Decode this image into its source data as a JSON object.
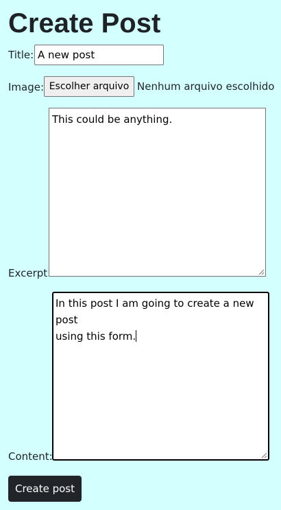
{
  "page": {
    "title": "Create Post"
  },
  "form": {
    "title_label": "Title:",
    "title_value": "A new post",
    "image_label": "Image:",
    "file_button_label": "Escolher arquivo",
    "file_status": "Nenhum arquivo escolhido",
    "excerpt_label": "Excerpt:",
    "excerpt_value": "This could be anything.",
    "content_label": "Content:",
    "content_line_1": "In this post I am going to create a new post",
    "content_line_2": "using this form.",
    "submit_label": "Create post"
  },
  "colors": {
    "background": "#d4ffff",
    "text": "#1e2226",
    "submit_background": "#212529",
    "submit_text": "#ffffff",
    "file_button_background": "#efefef"
  }
}
